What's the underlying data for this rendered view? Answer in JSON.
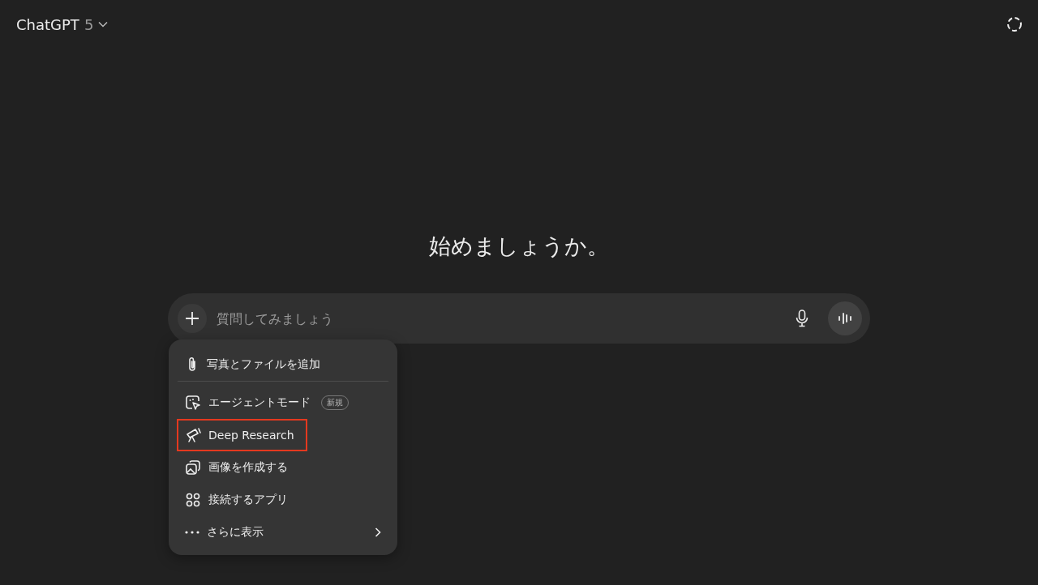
{
  "header": {
    "model": "ChatGPT",
    "version": "5"
  },
  "heading": "始めましょうか。",
  "composer": {
    "placeholder": "質問してみましょう"
  },
  "menu": {
    "items": [
      {
        "kind": "attach",
        "label": "写真とファイルを追加",
        "divider_after": true,
        "highlighted": false,
        "submenu": false
      },
      {
        "kind": "agent",
        "label": "エージェントモード",
        "badge": "新規",
        "divider_after": false,
        "highlighted": false,
        "submenu": false
      },
      {
        "kind": "research",
        "label": "Deep Research",
        "divider_after": false,
        "highlighted": true,
        "submenu": false
      },
      {
        "kind": "image",
        "label": "画像を作成する",
        "divider_after": false,
        "highlighted": false,
        "submenu": false
      },
      {
        "kind": "apps",
        "label": "接続するアプリ",
        "divider_after": false,
        "highlighted": false,
        "submenu": false
      },
      {
        "kind": "more",
        "label": "さらに表示",
        "divider_after": false,
        "highlighted": false,
        "submenu": true
      }
    ]
  }
}
